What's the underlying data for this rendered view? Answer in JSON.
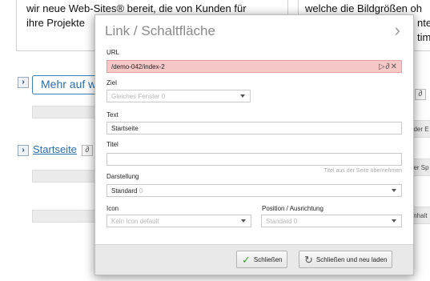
{
  "background": {
    "text_left_line1": "wir neue Web-Sites® bereit, die von Kunden für",
    "text_left_line2": "ihre Projekte",
    "text_right_line1": "welche die Bildgrößen oh",
    "text_right_line2": "nter",
    "text_right_line3": "timie",
    "button_label": "Mehr auf we",
    "link_label": "Startseite",
    "side_label_1": "t der E",
    "side_label_2": "der Sp",
    "side_label_3": "Inhalt"
  },
  "modal": {
    "title": "Link / Schaltfläche",
    "url": {
      "label": "URL",
      "value": "/demo-042/index-2"
    },
    "ziel": {
      "label": "Ziel",
      "value": "Gleiches Fenster",
      "count": "0"
    },
    "text": {
      "label": "Text",
      "value": "Startseite"
    },
    "titel": {
      "label": "Titel",
      "value": "",
      "hint": "Titel aus der Seite übernehmen"
    },
    "darstellung": {
      "label": "Darstellung",
      "value": "Standard",
      "count": "0"
    },
    "icon": {
      "label": "Icon",
      "value": "Kein Icon default"
    },
    "position": {
      "label": "Position / Ausrichtung",
      "value": "Standard",
      "count": "0"
    },
    "buttons": {
      "close": "Schließen",
      "close_reload": "Schließen und neu laden"
    }
  }
}
